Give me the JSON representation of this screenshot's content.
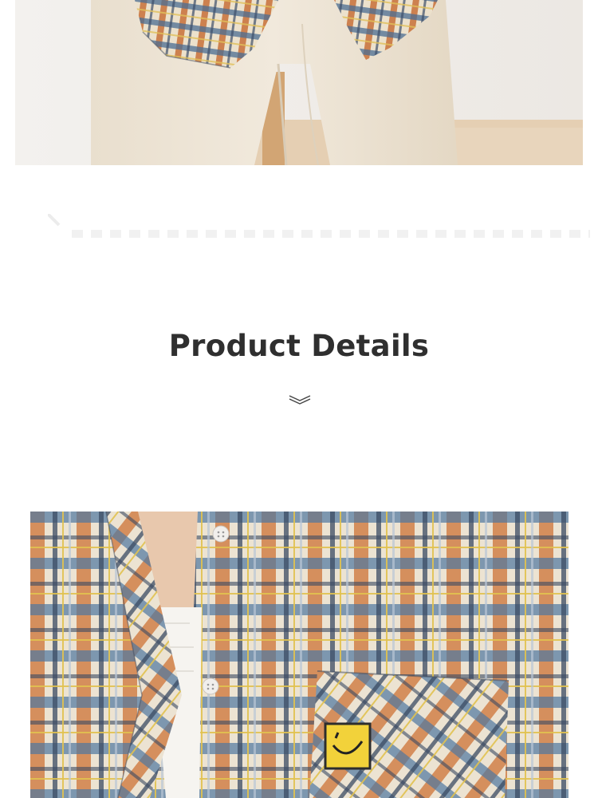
{
  "section": {
    "title": "Product Details",
    "divider_icon": "double-chevron-down-icon"
  },
  "images": {
    "top": "plaid-shirt-and-cream-pants-photo",
    "bottom": "plaid-shirt-closeup-photo"
  },
  "colors": {
    "title": "#2f2f2f",
    "plaid_orange": "#c8703a",
    "plaid_blue": "#4a6d93",
    "plaid_cream": "#ece1cc",
    "pants_cream": "#ede3d3"
  }
}
